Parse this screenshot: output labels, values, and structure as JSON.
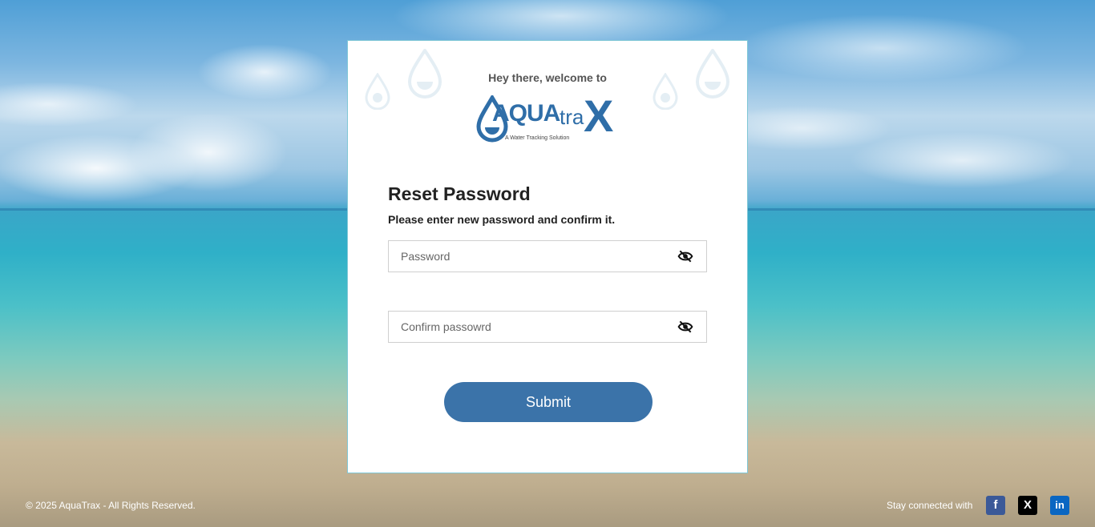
{
  "welcome_text": "Hey there, welcome to",
  "logo": {
    "aqua": "AQUA",
    "tra": "tra",
    "x": "X",
    "tagline": "A Water Tracking Solution"
  },
  "form": {
    "title": "Reset Password",
    "subtitle": "Please enter new password and confirm it.",
    "password_placeholder": "Password",
    "confirm_placeholder": "Confirm passowrd",
    "submit_label": "Submit"
  },
  "footer": {
    "copyright": "© 2025 AquaTrax - All Rights Reserved.",
    "stay_connected": "Stay connected with",
    "social": [
      {
        "name": "facebook-icon",
        "glyph": "f",
        "color": "#3b5998"
      },
      {
        "name": "x-twitter-icon",
        "glyph": "X",
        "color": "#000000"
      },
      {
        "name": "linkedin-icon",
        "glyph": "in",
        "color": "#0a66c2"
      }
    ]
  },
  "colors": {
    "brand": "#2f6ea8",
    "button": "#3b73a9"
  }
}
